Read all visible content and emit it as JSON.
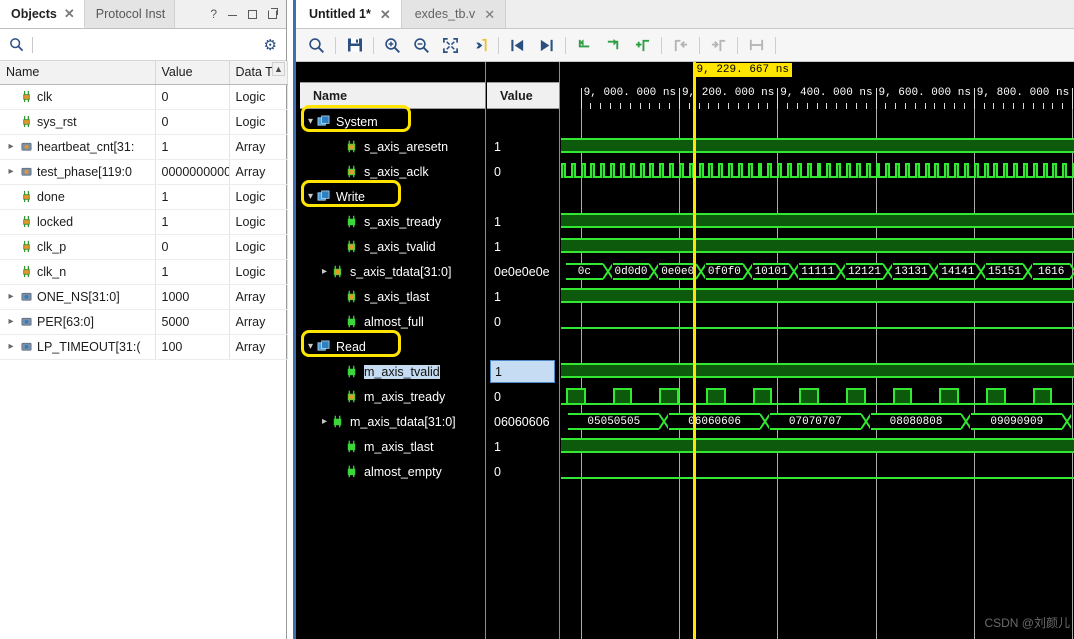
{
  "objects_panel": {
    "tabs": [
      {
        "label": "Objects",
        "active": true,
        "closable": true
      },
      {
        "label": "Protocol Inst",
        "active": false,
        "closable": false
      }
    ],
    "window_buttons": [
      "?",
      "minimize",
      "maximize",
      "popout"
    ],
    "search": {
      "value": "",
      "placeholder": ""
    },
    "settings_icon": "gear-icon",
    "columns": [
      "Name",
      "Value",
      "Data T"
    ],
    "rows": [
      {
        "name": "clk",
        "value": "0",
        "type": "Logic",
        "expandable": false,
        "icon": "logic-pin-icon"
      },
      {
        "name": "sys_rst",
        "value": "0",
        "type": "Logic",
        "expandable": false,
        "icon": "logic-pin-icon"
      },
      {
        "name": "heartbeat_cnt[31:",
        "value": "1",
        "type": "Array",
        "expandable": true,
        "icon": "array-pin-icon"
      },
      {
        "name": "test_phase[119:0",
        "value": "0000000000",
        "type": "Array",
        "expandable": true,
        "icon": "array-pin-icon"
      },
      {
        "name": "done",
        "value": "1",
        "type": "Logic",
        "expandable": false,
        "icon": "logic-pin-icon"
      },
      {
        "name": "locked",
        "value": "1",
        "type": "Logic",
        "expandable": false,
        "icon": "logic-pin-icon"
      },
      {
        "name": "clk_p",
        "value": "0",
        "type": "Logic",
        "expandable": false,
        "icon": "logic-pin-icon"
      },
      {
        "name": "clk_n",
        "value": "1",
        "type": "Logic",
        "expandable": false,
        "icon": "logic-pin-icon"
      },
      {
        "name": "ONE_NS[31:0]",
        "value": "1000",
        "type": "Array",
        "expandable": true,
        "icon": "const-pin-icon"
      },
      {
        "name": "PER[63:0]",
        "value": "5000",
        "type": "Array",
        "expandable": true,
        "icon": "const-pin-icon"
      },
      {
        "name": "LP_TIMEOUT[31:(",
        "value": "100",
        "type": "Array",
        "expandable": true,
        "icon": "const-pin-icon"
      }
    ]
  },
  "wave_window": {
    "tabs": [
      {
        "label": "Untitled 1*",
        "active": true
      },
      {
        "label": "exdes_tb.v",
        "active": false
      }
    ],
    "toolbar": [
      {
        "name": "search-icon",
        "glyph": "search"
      },
      {
        "name": "save-icon",
        "glyph": "save"
      },
      {
        "name": "zoom-in-icon",
        "glyph": "zoom-in"
      },
      {
        "name": "zoom-out-icon",
        "glyph": "zoom-out"
      },
      {
        "name": "zoom-fit-icon",
        "glyph": "fit"
      },
      {
        "name": "goto-time-icon",
        "glyph": "goto"
      },
      {
        "name": "previous-transition-icon",
        "glyph": "prev"
      },
      {
        "name": "next-transition-icon",
        "glyph": "next"
      },
      {
        "name": "prev-marker-icon",
        "glyph": "prevmark"
      },
      {
        "name": "next-marker-icon",
        "glyph": "nextmark"
      },
      {
        "name": "add-marker-icon",
        "glyph": "addmark"
      },
      {
        "name": "marker-left-icon",
        "glyph": "markleft"
      },
      {
        "name": "marker-right-icon",
        "glyph": "markright"
      },
      {
        "name": "measure-icon",
        "glyph": "measure"
      }
    ],
    "columns": {
      "name": "Name",
      "value": "Value"
    },
    "signals": [
      {
        "label": "System",
        "value": "",
        "kind": "group",
        "indent": 0,
        "expanded": true,
        "icon": "scope-icon",
        "annotated": true,
        "selected": false
      },
      {
        "label": "s_axis_aresetn",
        "value": "1",
        "kind": "signal",
        "indent": 2,
        "expanded": null,
        "icon": "input-pin-icon",
        "annotated": false,
        "selected": false
      },
      {
        "label": "s_axis_aclk",
        "value": "0",
        "kind": "clock",
        "indent": 2,
        "expanded": null,
        "icon": "input-pin-icon",
        "annotated": false,
        "selected": false
      },
      {
        "label": "Write",
        "value": "",
        "kind": "group",
        "indent": 0,
        "expanded": true,
        "icon": "scope-icon",
        "annotated": true,
        "selected": false
      },
      {
        "label": "s_axis_tready",
        "value": "1",
        "kind": "signal",
        "indent": 2,
        "expanded": null,
        "icon": "output-pin-icon",
        "annotated": false,
        "selected": false
      },
      {
        "label": "s_axis_tvalid",
        "value": "1",
        "kind": "signal",
        "indent": 2,
        "expanded": null,
        "icon": "input-pin-icon",
        "annotated": false,
        "selected": false
      },
      {
        "label": "s_axis_tdata[31:0]",
        "value": "0e0e0e0e",
        "kind": "bus",
        "indent": 1,
        "expanded": false,
        "icon": "input-bus-icon",
        "annotated": false,
        "selected": false
      },
      {
        "label": "s_axis_tlast",
        "value": "1",
        "kind": "signal",
        "indent": 2,
        "expanded": null,
        "icon": "input-pin-icon",
        "annotated": false,
        "selected": false
      },
      {
        "label": "almost_full",
        "value": "0",
        "kind": "signal",
        "indent": 2,
        "expanded": null,
        "icon": "output-pin-icon",
        "annotated": false,
        "selected": false
      },
      {
        "label": "Read",
        "value": "",
        "kind": "group",
        "indent": 0,
        "expanded": true,
        "icon": "scope-icon",
        "annotated": true,
        "selected": false
      },
      {
        "label": "m_axis_tvalid",
        "value": "1",
        "kind": "signal",
        "indent": 2,
        "expanded": null,
        "icon": "output-pin-icon",
        "annotated": false,
        "selected": true
      },
      {
        "label": "m_axis_tready",
        "value": "0",
        "kind": "signal",
        "indent": 2,
        "expanded": null,
        "icon": "input-pin-icon",
        "annotated": false,
        "selected": false
      },
      {
        "label": "m_axis_tdata[31:0]",
        "value": "06060606",
        "kind": "bus",
        "indent": 1,
        "expanded": false,
        "icon": "output-bus-icon",
        "annotated": false,
        "selected": false
      },
      {
        "label": "m_axis_tlast",
        "value": "1",
        "kind": "signal",
        "indent": 2,
        "expanded": null,
        "icon": "output-pin-icon",
        "annotated": false,
        "selected": false
      },
      {
        "label": "almost_empty",
        "value": "0",
        "kind": "signal",
        "indent": 2,
        "expanded": null,
        "icon": "output-pin-icon",
        "annotated": false,
        "selected": false
      }
    ],
    "cursor": {
      "time_label": "9, 229. 667 ns",
      "time_ns": 9229.667
    },
    "ruler": {
      "unit": "ns",
      "ticks": [
        "9, 000. 000 ns",
        "9, 200. 000 ns",
        "9, 400. 000 ns",
        "9, 600. 000 ns",
        "9, 800. 000 ns",
        "1"
      ],
      "tick_times": [
        9000,
        9200,
        9400,
        9600,
        9800,
        10000
      ],
      "range_start_ns": 8960,
      "range_end_ns": 10010
    },
    "write_bus_segments": [
      "0c",
      "0d0d0",
      "0e0e0",
      "0f0f0",
      "10101",
      "11111",
      "12121",
      "13131",
      "14141",
      "15151",
      "1616"
    ],
    "read_bus_segments": [
      "05050505",
      "06060606",
      "07070707",
      "08080808",
      "09090909"
    ],
    "watermark": "CSDN @刘颜儿"
  }
}
